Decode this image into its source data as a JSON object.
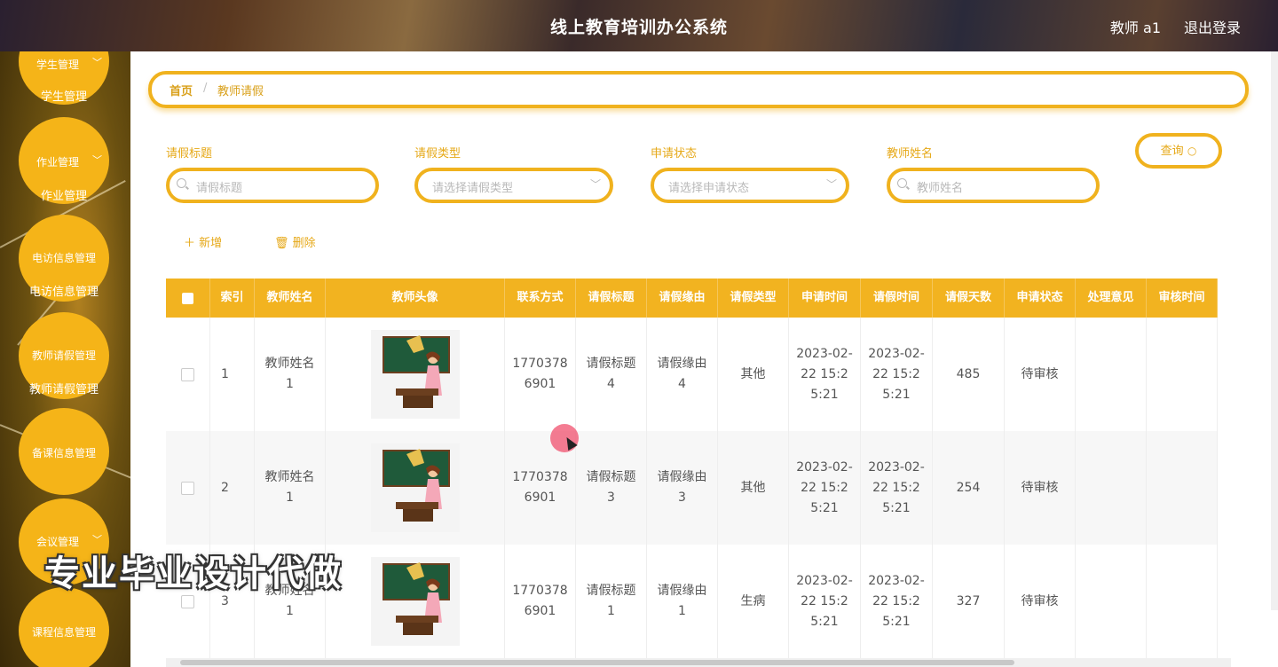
{
  "header": {
    "title": "线上教育培训办公系统",
    "user": "教师 a1",
    "logout": "退出登录"
  },
  "sidebar": {
    "menus": [
      {
        "label": "学生管理",
        "sub": "学生管理",
        "has_children": true
      },
      {
        "label": "作业管理",
        "sub": "作业管理",
        "has_children": true
      },
      {
        "label": "电访信息管理",
        "sub": "电访信息管理",
        "has_children": false
      },
      {
        "label": "教师请假管理",
        "sub": "教师请假管理",
        "has_children": false
      },
      {
        "label": "备课信息管理",
        "sub": "",
        "has_children": false
      },
      {
        "label": "会议管理",
        "sub": "",
        "has_children": true
      },
      {
        "label": "课程信息管理",
        "sub": "",
        "has_children": false
      }
    ]
  },
  "breadcrumb": {
    "home": "首页",
    "separator": "/",
    "current": "教师请假"
  },
  "filters": {
    "title_label": "请假标题",
    "title_placeholder": "请假标题",
    "type_label": "请假类型",
    "type_placeholder": "请选择请假类型",
    "status_label": "申请状态",
    "status_placeholder": "请选择申请状态",
    "teacher_label": "教师姓名",
    "teacher_placeholder": "教师姓名",
    "query": "查询"
  },
  "toolbar": {
    "add": "新增",
    "delete": "删除"
  },
  "table": {
    "columns": [
      "",
      "索引",
      "教师姓名",
      "教师头像",
      "联系方式",
      "请假标题",
      "请假缘由",
      "请假类型",
      "申请时间",
      "请假时间",
      "请假天数",
      "申请状态",
      "处理意见",
      "审核时间"
    ],
    "rows": [
      {
        "index": "1",
        "name": "教师姓名1",
        "phone": "17703786901",
        "title": "请假标题4",
        "reason": "请假缘由4",
        "type": "其他",
        "apply_time": "2023-02-22 15:25:21",
        "leave_time": "2023-02-22 15:25:21",
        "days": "485",
        "status": "待审核",
        "opinion": "",
        "review_time": ""
      },
      {
        "index": "2",
        "name": "教师姓名1",
        "phone": "17703786901",
        "title": "请假标题3",
        "reason": "请假缘由3",
        "type": "其他",
        "apply_time": "2023-02-22 15:25:21",
        "leave_time": "2023-02-22 15:25:21",
        "days": "254",
        "status": "待审核",
        "opinion": "",
        "review_time": ""
      },
      {
        "index": "3",
        "name": "教师姓名1",
        "phone": "17703786901",
        "title": "请假标题1",
        "reason": "请假缘由1",
        "type": "生病",
        "apply_time": "2023-02-22 15:25:21",
        "leave_time": "2023-02-22 15:25:21",
        "days": "327",
        "status": "待审核",
        "opinion": "",
        "review_time": ""
      }
    ]
  },
  "watermark": "专业毕业设计代做",
  "colors": {
    "accent": "#f2b320",
    "accent_text": "#e6a817"
  }
}
